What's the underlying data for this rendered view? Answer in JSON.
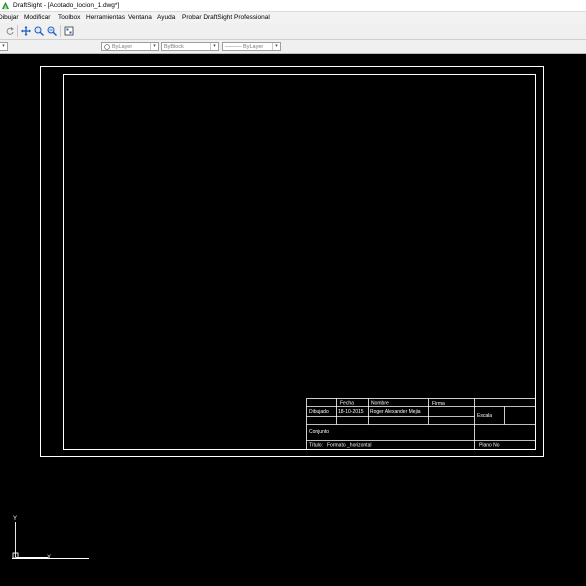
{
  "window": {
    "title": "DraftSight - [Acotado_locion_1.dwg*]"
  },
  "menubar": {
    "items": [
      "Dibujar",
      "Modificar",
      "Toolbox",
      "Herramientas",
      "Ventana",
      "Ayuda",
      "Probar DraftSight Professional"
    ]
  },
  "toolbar": {
    "icons": [
      "redo-icon",
      "pan-icon",
      "zoom-window-icon",
      "zoom-previous-icon",
      "properties-icon"
    ]
  },
  "properties_bar": {
    "color": "ByLayer",
    "linestyle": "ByBlock",
    "lineweight": "——— ByLayer"
  },
  "title_block": {
    "fecha_label": "Fecha",
    "nombre_label": "Nombre",
    "firma_label": "Firma",
    "dibujado_label": "Dibujado",
    "fecha_value": "18-10-2015",
    "nombre_value": "Roger Alexander Mejia",
    "escala_label": "Escala",
    "conjunto_label": "Conjunto",
    "titulo_label": "Título:",
    "titulo_value": "Formato _horizontal",
    "plano_label": "Plano No"
  },
  "ucs": {
    "x_label": "X",
    "y_label": "Y"
  },
  "colors": {
    "canvas": "#000000",
    "drawing_lines": "#ffffff",
    "ucs": "#ffffff"
  }
}
